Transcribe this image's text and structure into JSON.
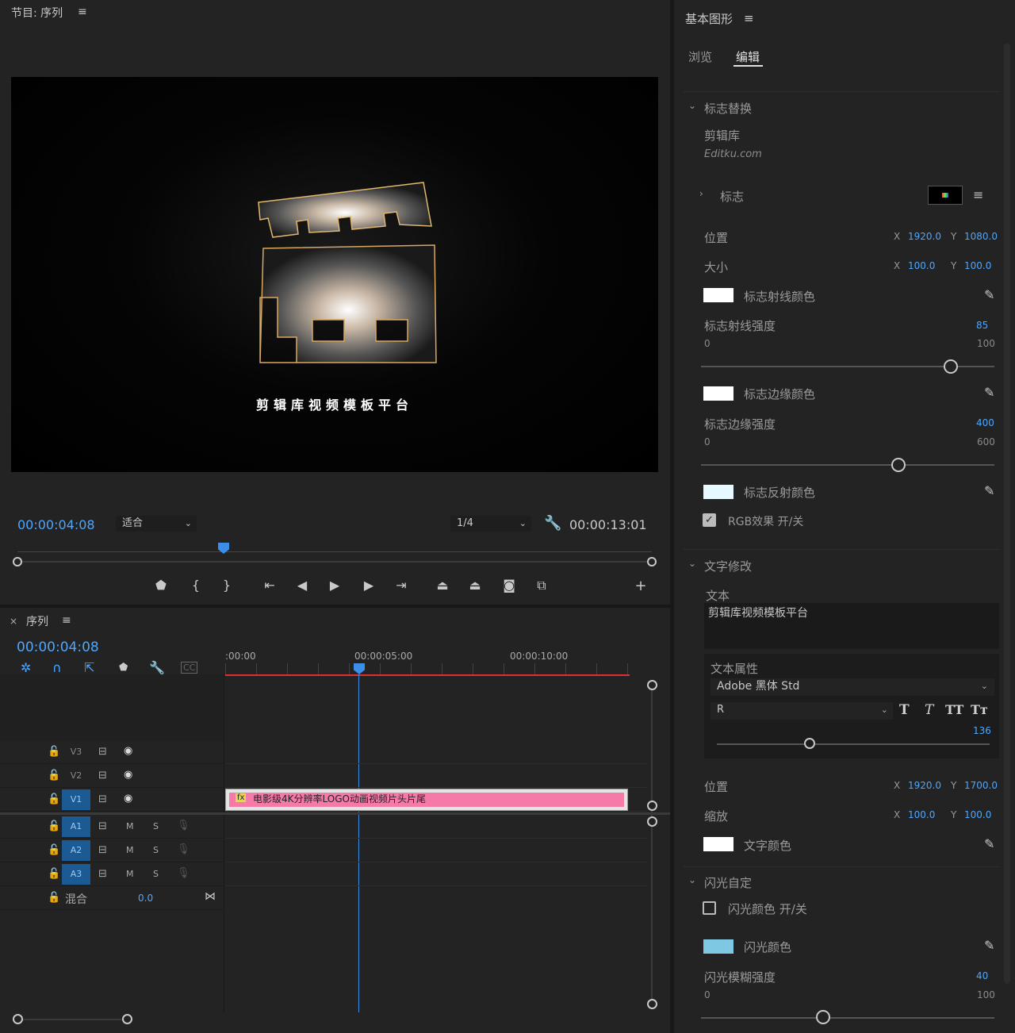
{
  "program": {
    "title": "节目: 序列",
    "timecode": "00:00:04:08",
    "fit": "适合",
    "resolution": "1/4",
    "duration": "00:00:13:01",
    "overlay_text": "剪辑库视频模板平台"
  },
  "sequence": {
    "title": "序列",
    "timecode": "00:00:04:08",
    "ruler": [
      ":00:00",
      "00:00:05:00",
      "00:00:10:00"
    ],
    "tracks_video": [
      {
        "name": "V3",
        "active": false
      },
      {
        "name": "V2",
        "active": false
      },
      {
        "name": "V1",
        "active": true
      }
    ],
    "tracks_audio": [
      {
        "name": "A1",
        "m": "M",
        "s": "S"
      },
      {
        "name": "A2",
        "m": "M",
        "s": "S"
      },
      {
        "name": "A3",
        "m": "M",
        "s": "S"
      }
    ],
    "mix_label": "混合",
    "mix_value": "0.0",
    "clip_label": "电影级4K分辨率LOGO动画视频片头片尾",
    "clip_fx": "fx"
  },
  "graphics": {
    "title": "基本图形",
    "tabs": [
      "浏览",
      "编辑"
    ],
    "section1": "标志替换",
    "brand": "剪辑库",
    "brand_sub": "Editku.com",
    "logo_label": "标志",
    "pos_label": "位置",
    "pos_x": "1920.0",
    "pos_y": "1080.0",
    "size_label": "大小",
    "size_x": "100.0",
    "size_y": "100.0",
    "ray_color_label": "标志射线颜色",
    "ray_strength_label": "标志射线强度",
    "ray_strength": "85",
    "ray_min": "0",
    "ray_max": "100",
    "edge_color_label": "标志边缘颜色",
    "edge_strength_label": "标志边缘强度",
    "edge_strength": "400",
    "edge_min": "0",
    "edge_max": "600",
    "refl_color_label": "标志反射颜色",
    "rgb_label": "RGB效果 开/关",
    "section2": "文字修改",
    "text_label": "文本",
    "text_value": "剪辑库视频模板平台",
    "text_props": "文本属性",
    "font": "Adobe 黑体 Std",
    "font_style": "R",
    "font_size": "136",
    "tpos_label": "位置",
    "tpos_x": "1920.0",
    "tpos_y": "1700.0",
    "scale_label": "缩放",
    "scale_x": "100.0",
    "scale_y": "100.0",
    "text_color_label": "文字颜色",
    "section3": "闪光自定",
    "flash_toggle": "闪光颜色 开/关",
    "flash_color_label": "闪光颜色",
    "blur_label": "闪光模糊强度",
    "blur_value": "40",
    "blur_min": "0",
    "blur_max": "100",
    "x": "X",
    "y": "Y"
  },
  "colors": {
    "accent": "#4da6ff",
    "clip": "#f57aa8",
    "flash": "#7ec8e3",
    "playhead": "#3b8fe6"
  }
}
